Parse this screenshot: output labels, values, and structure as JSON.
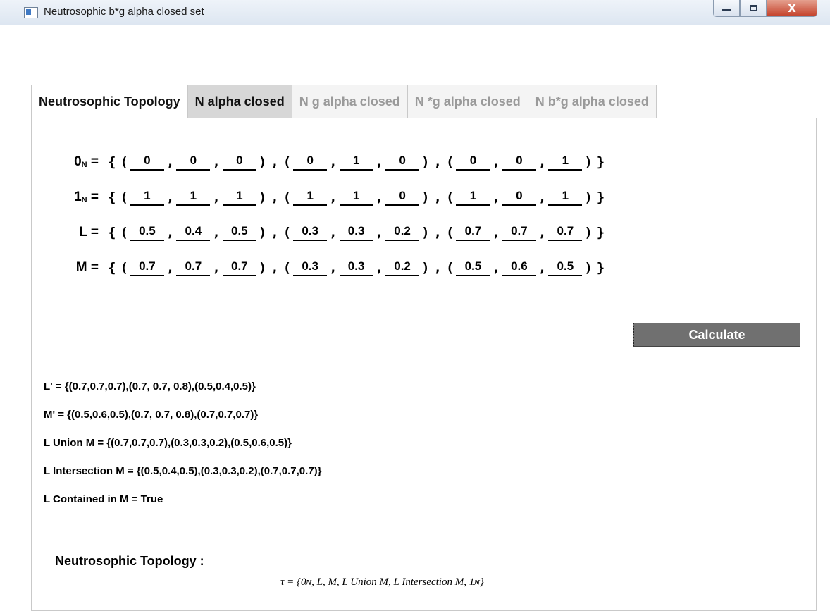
{
  "window": {
    "title": "Neutrosophic b*g alpha closed set",
    "close_glyph": "X"
  },
  "tabs": [
    {
      "label": "Neutrosophic Topology"
    },
    {
      "label": "N alpha closed"
    },
    {
      "label": "N g alpha closed"
    },
    {
      "label": "N *g alpha closed"
    },
    {
      "label": "N b*g alpha closed"
    }
  ],
  "sets": [
    {
      "label": "0",
      "sub": "N",
      "triples": [
        [
          "0",
          "0",
          "0"
        ],
        [
          "0",
          "1",
          "0"
        ],
        [
          "0",
          "0",
          "1"
        ]
      ]
    },
    {
      "label": "1",
      "sub": "N",
      "triples": [
        [
          "1",
          "1",
          "1"
        ],
        [
          "1",
          "1",
          "0"
        ],
        [
          "1",
          "0",
          "1"
        ]
      ]
    },
    {
      "label": "L",
      "sub": "",
      "triples": [
        [
          "0.5",
          "0.4",
          "0.5"
        ],
        [
          "0.3",
          "0.3",
          "0.2"
        ],
        [
          "0.7",
          "0.7",
          "0.7"
        ]
      ]
    },
    {
      "label": "M",
      "sub": "",
      "triples": [
        [
          "0.7",
          "0.7",
          "0.7"
        ],
        [
          "0.3",
          "0.3",
          "0.2"
        ],
        [
          "0.5",
          "0.6",
          "0.5"
        ]
      ]
    }
  ],
  "calculate_label": "Calculate",
  "results": {
    "l_complement": "L' = {(0.7,0.7,0.7),(0.7, 0.7, 0.8),(0.5,0.4,0.5)}",
    "m_complement": "M' = {(0.5,0.6,0.5),(0.7, 0.7, 0.8),(0.7,0.7,0.7)}",
    "union": "L Union M = {(0.7,0.7,0.7),(0.3,0.3,0.2),(0.5,0.6,0.5)}",
    "intersection": "L Intersection M = {(0.5,0.4,0.5),(0.3,0.3,0.2),(0.7,0.7,0.7)}",
    "contained": "L Contained in M = True"
  },
  "topology": {
    "heading": "Neutrosophic Topology :",
    "formula": "τ = {0ɴ, L, M, L Union M, L Intersection M, 1ɴ}"
  }
}
